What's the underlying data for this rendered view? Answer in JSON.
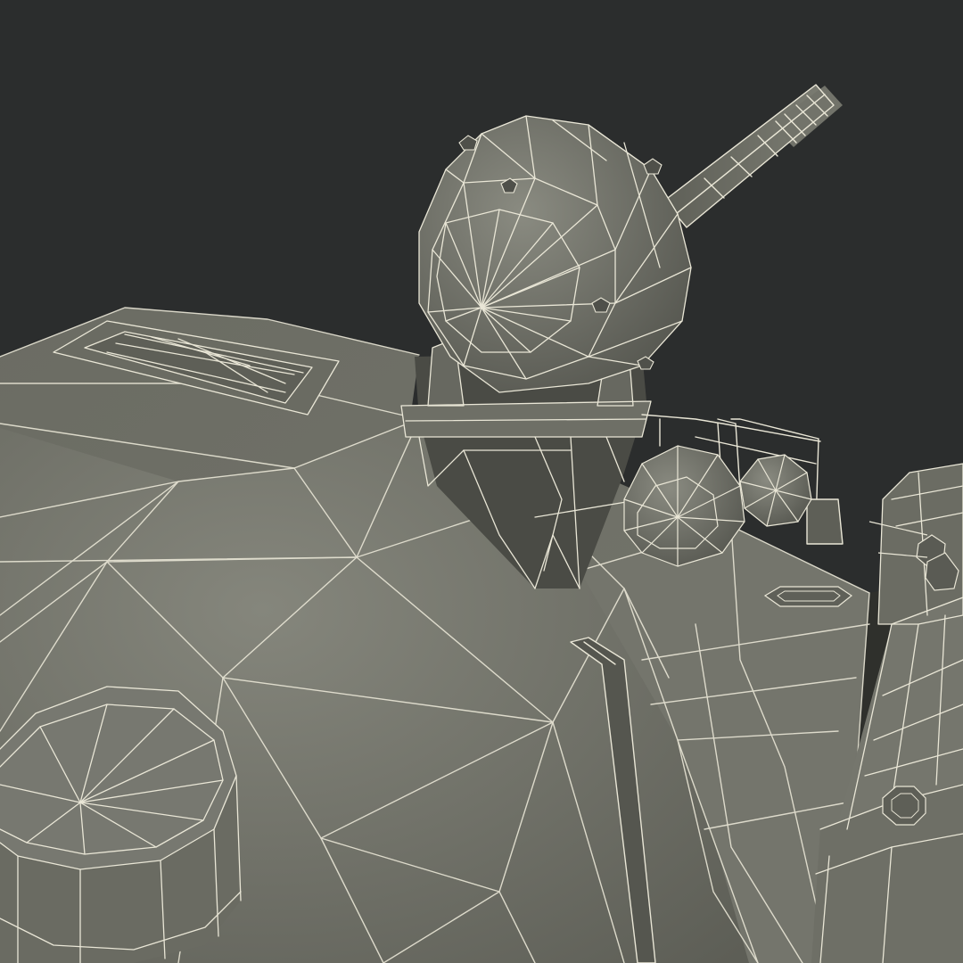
{
  "scene": {
    "subject": "3d-wireframe-render",
    "colors": {
      "background": "#2b2d2d",
      "surface": "#6e6f66",
      "surface_light": "#7d7e75",
      "surface_dark": "#55564f",
      "shadow": "#3e3f3a",
      "wire": "#e9e6d6"
    }
  }
}
